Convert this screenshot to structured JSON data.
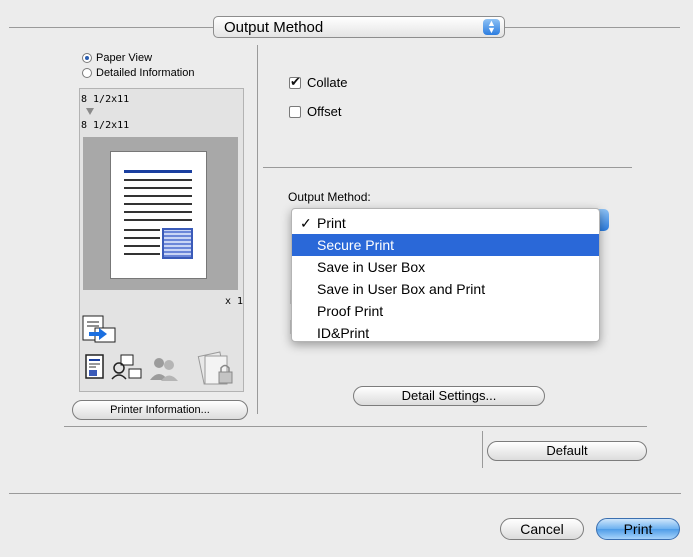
{
  "header": {
    "popup_label": "Output Method"
  },
  "view_options": [
    {
      "label": "Paper View",
      "selected": true
    },
    {
      "label": "Detailed Information",
      "selected": false
    }
  ],
  "preview": {
    "input_size": "8 1/2x11",
    "output_size": "8 1/2x11",
    "copies": "x 1"
  },
  "printer_info_button": "Printer Information...",
  "options": {
    "collate": {
      "label": "Collate",
      "checked": true
    },
    "offset": {
      "label": "Offset",
      "checked": false
    }
  },
  "output_method": {
    "label": "Output Method:",
    "menu_items": [
      {
        "label": "Print",
        "checked": true,
        "highlighted": false
      },
      {
        "label": "Secure Print",
        "checked": false,
        "highlighted": true
      },
      {
        "label": "Save in User Box",
        "checked": false,
        "highlighted": false
      },
      {
        "label": "Save in User Box and Print",
        "checked": false,
        "highlighted": false
      },
      {
        "label": "Proof Print",
        "checked": false,
        "highlighted": false
      },
      {
        "label": "ID&Print",
        "checked": false,
        "highlighted": false
      }
    ],
    "checkmark": "✓"
  },
  "detail_settings_button": "Detail Settings...",
  "default_button": "Default",
  "footer": {
    "cancel": "Cancel",
    "print": "Print"
  },
  "colors": {
    "accent": "#2a68d8",
    "highlight": "#2a68d8"
  }
}
